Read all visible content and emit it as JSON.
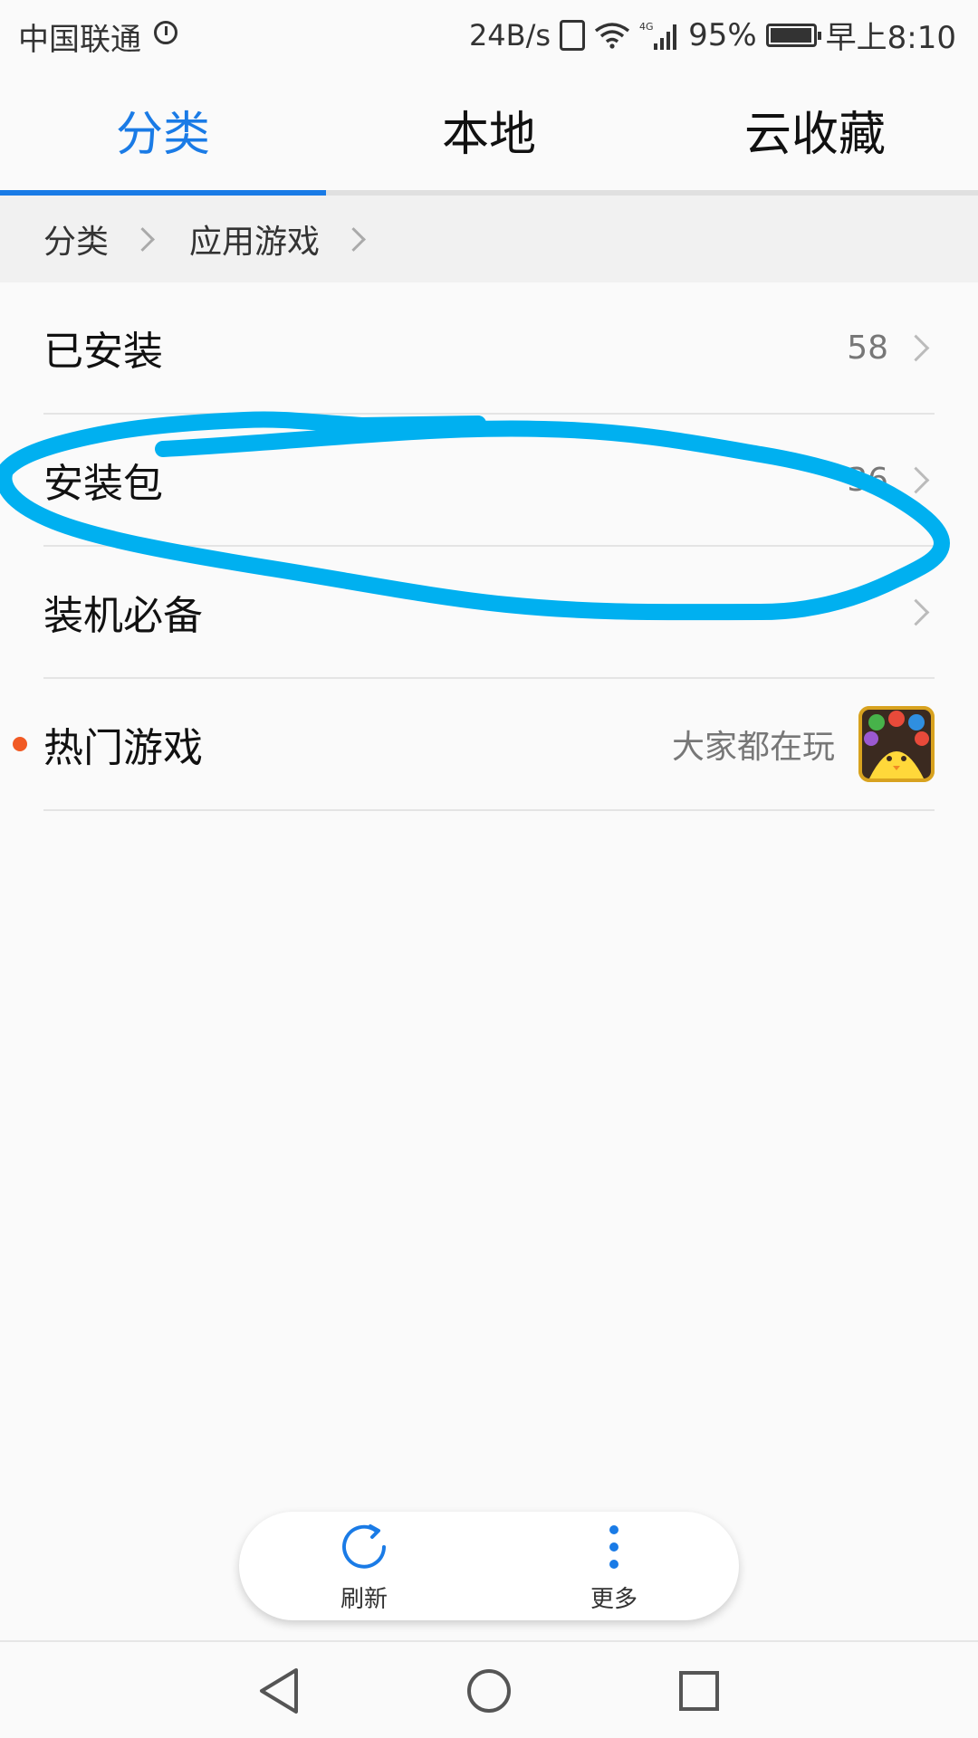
{
  "status_bar": {
    "carrier": "中国联通",
    "net_speed": "24B/s",
    "network_type": "4G",
    "battery": "95%",
    "time": "早上8:10"
  },
  "tabs": [
    {
      "label": "分类",
      "active": true
    },
    {
      "label": "本地",
      "active": false
    },
    {
      "label": "云收藏",
      "active": false
    }
  ],
  "breadcrumb": [
    "分类",
    "应用游戏"
  ],
  "list": {
    "items": [
      {
        "label": "已安装",
        "value": "58"
      },
      {
        "label": "安装包",
        "value": "36"
      },
      {
        "label": "装机必备",
        "value": ""
      },
      {
        "label": "热门游戏",
        "value": "大家都在玩"
      }
    ]
  },
  "actions": {
    "refresh_label": "刷新",
    "more_label": "更多"
  },
  "colors": {
    "accent": "#1a7be6",
    "annotation": "#00b0f0",
    "hot_dot": "#f15a24"
  }
}
